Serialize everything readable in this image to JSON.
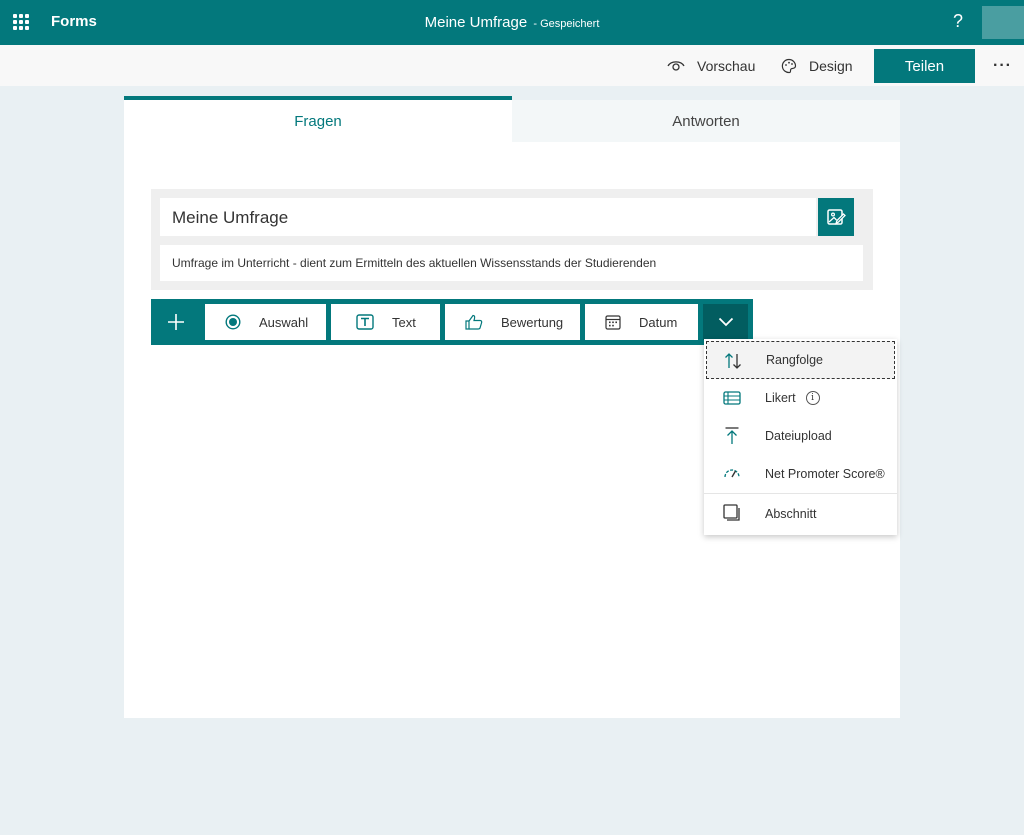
{
  "topbar": {
    "app_name": "Forms",
    "doc_title": "Meine Umfrage",
    "doc_status": "- Gespeichert",
    "help_label": "?"
  },
  "cmdbar": {
    "preview_label": "Vorschau",
    "design_label": "Design",
    "share_label": "Teilen",
    "more_label": "···"
  },
  "tabs": [
    {
      "label": "Fragen",
      "active": true
    },
    {
      "label": "Antworten",
      "active": false
    }
  ],
  "form": {
    "title": "Meine Umfrage",
    "description": "Umfrage im Unterricht - dient zum Ermitteln des aktuellen Wissensstands der Studierenden"
  },
  "question_types": [
    {
      "label": "Auswahl",
      "icon": "radio-icon"
    },
    {
      "label": "Text",
      "icon": "text-icon"
    },
    {
      "label": "Bewertung",
      "icon": "thumbs-up-icon"
    },
    {
      "label": "Datum",
      "icon": "calendar-icon"
    }
  ],
  "more_types": [
    {
      "label": "Rangfolge",
      "icon": "ranking-icon",
      "focused": true
    },
    {
      "label": "Likert",
      "icon": "likert-icon",
      "info": "i"
    },
    {
      "label": "Dateiupload",
      "icon": "upload-icon"
    },
    {
      "label": "Net Promoter Score®",
      "icon": "gauge-icon"
    },
    {
      "label": "Abschnitt",
      "icon": "section-icon"
    }
  ],
  "colors": {
    "brand": "#03787c",
    "brand_dark": "#025d60",
    "background": "#e9f0f3"
  }
}
